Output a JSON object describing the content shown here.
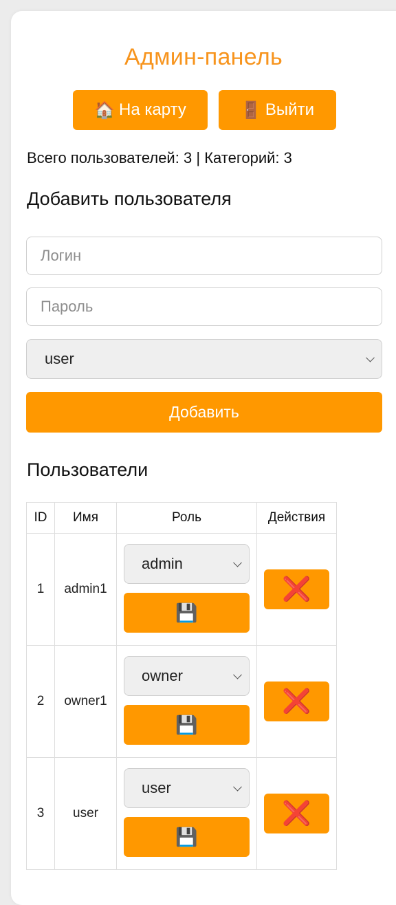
{
  "title": "Админ-панель",
  "nav": {
    "map": {
      "icon": "🏠",
      "label": "На карту"
    },
    "logout": {
      "icon": "🚪",
      "label": "Выйти"
    }
  },
  "stats": {
    "users_label": "Всего пользователей:",
    "users_count": "3",
    "separator": "|",
    "categories_label": "Категорий:",
    "categories_count": "3"
  },
  "add_user": {
    "heading": "Добавить пользователя",
    "login_placeholder": "Логин",
    "password_placeholder": "Пароль",
    "role_value": "user",
    "submit_label": "Добавить"
  },
  "users": {
    "heading": "Пользователи",
    "columns": [
      "ID",
      "Имя",
      "Роль",
      "Действия"
    ],
    "save_icon": "💾",
    "delete_icon": "❌",
    "rows": [
      {
        "id": "1",
        "name": "admin1",
        "role": "admin"
      },
      {
        "id": "2",
        "name": "owner1",
        "role": "owner"
      },
      {
        "id": "3",
        "name": "user",
        "role": "user"
      }
    ]
  },
  "colors": {
    "accent": "#ff9800",
    "title": "#f7941d",
    "delete": "#e53935"
  }
}
